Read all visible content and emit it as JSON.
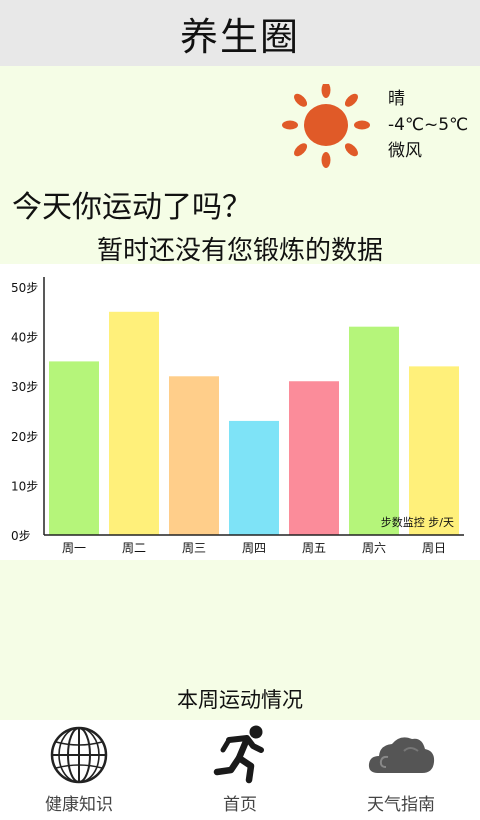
{
  "app": {
    "title": "养生圈"
  },
  "weather": {
    "condition": "晴",
    "temp_range": "-4℃~5℃",
    "wind": "微风",
    "icon": "sun-icon",
    "sun_color": "#e05a28"
  },
  "main": {
    "question": "今天你运动了吗？",
    "no_data": "暂时还没有您锻炼的数据",
    "weekly_label": "本周运动情况"
  },
  "chart_data": {
    "type": "bar",
    "categories": [
      "周一",
      "周二",
      "周三",
      "周四",
      "周五",
      "周六",
      "周日"
    ],
    "values": [
      35,
      45,
      32,
      23,
      31,
      42,
      34
    ],
    "colors": [
      "#b5f57a",
      "#fff07a",
      "#ffce8a",
      "#7ee3f7",
      "#fb8c9a",
      "#b5f57a",
      "#fff07a"
    ],
    "yticks": [
      "0步",
      "10步",
      "20步",
      "30步",
      "40步",
      "50步"
    ],
    "ylim": [
      0,
      50
    ],
    "annotation": "步数监控 步/天",
    "grid": false
  },
  "tabs": [
    {
      "label": "健康知识",
      "icon": "globe-icon"
    },
    {
      "label": "首页",
      "icon": "runner-icon"
    },
    {
      "label": "天气指南",
      "icon": "cloud-icon"
    }
  ]
}
